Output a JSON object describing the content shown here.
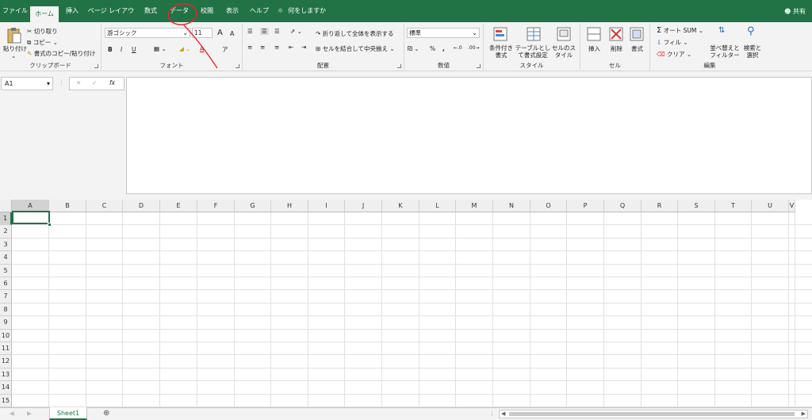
{
  "tabs": [
    "ファイル",
    "ホーム",
    "挿入",
    "ページ レイアウト",
    "数式",
    "データ",
    "校閲",
    "表示",
    "ヘルプ"
  ],
  "tell_me": "何をしますか",
  "share": "共有",
  "clipboard": {
    "paste": "貼り付け",
    "cut": "切り取り",
    "copy": "コピー",
    "format_painter": "書式のコピー/貼り付け",
    "label": "クリップボード"
  },
  "font": {
    "name": "游ゴシック",
    "size": "11",
    "label": "フォント",
    "bold": "B",
    "italic": "I",
    "underline": "U",
    "grow": "A",
    "shrink": "A",
    "color_letter": "A"
  },
  "alignment": {
    "wrap": "折り返して全体を表示する",
    "merge": "セルを結合して中央揃え",
    "label": "配置"
  },
  "number": {
    "format": "標準",
    "percent": "%",
    "comma": ",",
    "label": "数値"
  },
  "styles": {
    "conditional": "条件付き書式",
    "table": "テーブルとして書式設定",
    "cell": "セルのスタイル",
    "label": "スタイル"
  },
  "cells": {
    "insert": "挿入",
    "delete": "削除",
    "format": "書式",
    "label": "セル"
  },
  "editing": {
    "autosum": "オート SUM",
    "fill": "フィル",
    "clear": "クリア",
    "sort": "並べ替えとフィルター",
    "find": "検索と選択",
    "label": "編集"
  },
  "formula_bar": {
    "name_box": "A1",
    "fx": "fx",
    "value": ""
  },
  "columns": [
    "A",
    "B",
    "C",
    "D",
    "E",
    "F",
    "G",
    "H",
    "I",
    "J",
    "K",
    "L",
    "M",
    "N",
    "O",
    "P",
    "Q",
    "R",
    "S",
    "T",
    "U",
    "V"
  ],
  "rows": [
    "1",
    "2",
    "3",
    "4",
    "5",
    "6",
    "7",
    "8",
    "9",
    "10",
    "11",
    "12",
    "13",
    "14",
    "15"
  ],
  "sheet_tab": "Sheet1",
  "colors": {
    "excel_green": "#217346",
    "annotation_red": "#e8232a"
  }
}
